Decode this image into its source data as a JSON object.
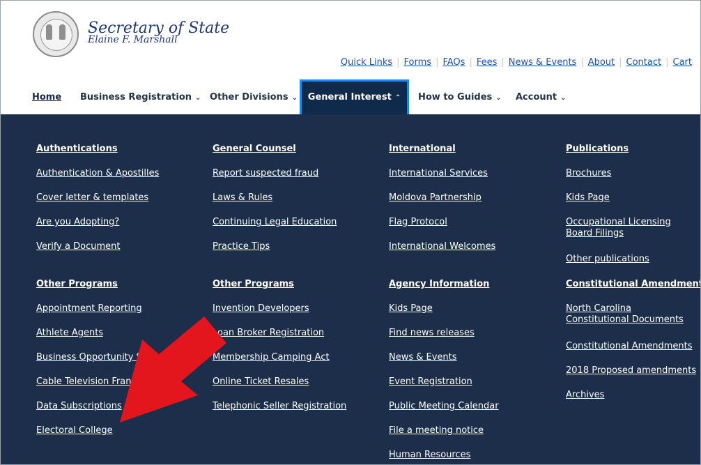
{
  "header": {
    "title": "Secretary of State",
    "subtitle": "Elaine F. Marshall"
  },
  "quick_links": [
    "Quick Links",
    "Forms",
    "FAQs",
    "Fees",
    "News & Events",
    "About",
    "Contact",
    "Cart"
  ],
  "nav": {
    "home": "Home",
    "business_registration": "Business Registration",
    "other_divisions": "Other Divisions",
    "general_interest": "General Interest",
    "how_to_guides": "How to Guides",
    "account": "Account"
  },
  "menu": {
    "col1": {
      "h1": "Authentications",
      "i1": "Authentication & Apostilles",
      "i2": "Cover letter & templates",
      "i3": "Are you Adopting?",
      "i4": "Verify a Document",
      "h2": "Other Programs",
      "i5": "Appointment Reporting",
      "i6": "Athlete Agents",
      "i7": "Business Opportunity Sales",
      "i8": "Cable Television Franchise",
      "i9": "Data Subscriptions",
      "i10": "Electoral College"
    },
    "col2": {
      "h1": "General Counsel",
      "i1": "Report suspected fraud",
      "i2": "Laws & Rules",
      "i3": "Continuing Legal Education",
      "i4": "Practice Tips",
      "h2": "Other Programs",
      "i5": "Invention Developers",
      "i6": "Loan Broker Registration",
      "i7": "Membership Camping Act",
      "i8": "Online Ticket Resales",
      "i9": "Telephonic Seller Registration"
    },
    "col3": {
      "h1": "International",
      "i1": "International Services",
      "i2": "Moldova Partnership",
      "i3": "Flag Protocol",
      "i4": "International Welcomes",
      "h2": "Agency Information",
      "i5": "Kids Page",
      "i6": "Find news releases",
      "i7": "News & Events",
      "i8": "Event Registration",
      "i9": "Public Meeting Calendar",
      "i10": "File a meeting notice",
      "i11": "Human Resources"
    },
    "col4": {
      "h1": "Publications",
      "i1": "Brochures",
      "i2": "Kids Page",
      "i3": "Occupational Licensing Board Filings",
      "i4": "Other publications",
      "h2": "Constitutional Amendments",
      "i5": "North Carolina Constitutional Documents",
      "i6": "Constitutional Amendments",
      "i7": "2018 Proposed amendments",
      "i8": "Archives"
    }
  },
  "colors": {
    "panel_bg": "#1c2e4a",
    "active_tab_bg": "#0f2a4b",
    "active_tab_border": "#1e88e5",
    "link_blue": "#1a55b5",
    "arrow_red": "#e3161d"
  },
  "icons": {
    "seal": "state-seal-icon",
    "chevron": "chevron-down-icon",
    "arrow": "red-arrow-annotation"
  }
}
